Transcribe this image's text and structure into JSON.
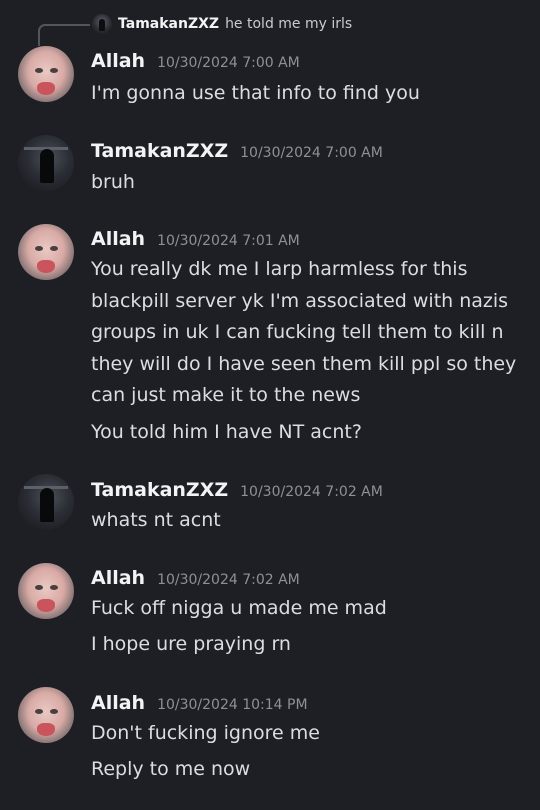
{
  "reply": {
    "author": "TamakanZXZ",
    "text": "he told me my irls"
  },
  "messages": [
    {
      "author": "Allah",
      "timestamp": "10/30/2024 7:00 AM",
      "avatar": "face-avatar",
      "lines": [
        "I'm gonna use that info to find you"
      ]
    },
    {
      "author": "TamakanZXZ",
      "timestamp": "10/30/2024 7:00 AM",
      "avatar": "dark-avatar",
      "lines": [
        "bruh"
      ]
    },
    {
      "author": "Allah",
      "timestamp": "10/30/2024 7:01 AM",
      "avatar": "face-avatar",
      "lines": [
        "You really dk me I larp harmless for this",
        "blackpill server yk I'm associated with nazis",
        "groups in uk I can fucking tell them to kill n",
        "they will do I have seen them kill ppl so they",
        "can just make it to the news",
        "You told him I have NT acnt?"
      ]
    },
    {
      "author": "TamakanZXZ",
      "timestamp": "10/30/2024 7:02 AM",
      "avatar": "dark-avatar",
      "lines": [
        "whats nt acnt"
      ]
    },
    {
      "author": "Allah",
      "timestamp": "10/30/2024 7:02 AM",
      "avatar": "face-avatar",
      "lines": [
        "Fuck off nigga u made me mad",
        "I hope ure praying rn"
      ]
    },
    {
      "author": "Allah",
      "timestamp": "10/30/2024 10:14 PM",
      "avatar": "face-avatar",
      "lines": [
        "Don't fucking ignore me",
        "Reply to me now"
      ]
    }
  ]
}
